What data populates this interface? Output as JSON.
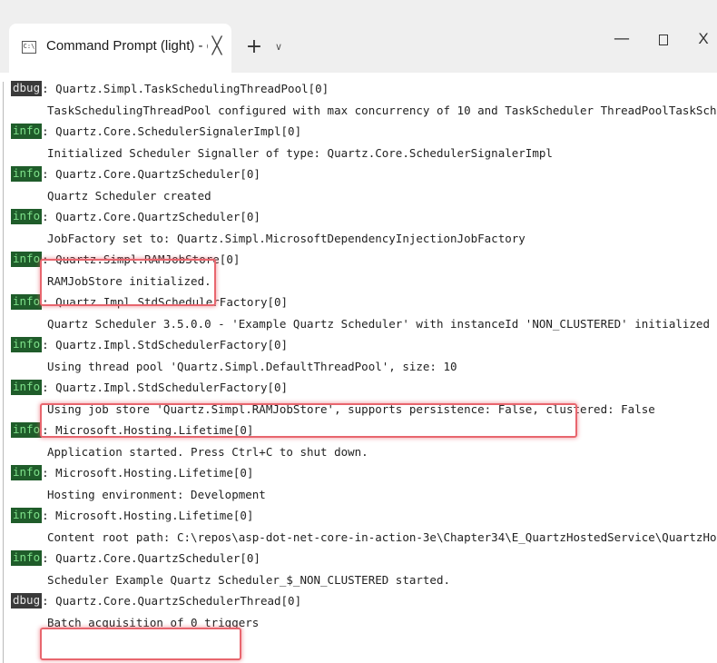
{
  "window": {
    "tab_title": "Command Prompt (light) - dot",
    "tab_icon_text": "C:\\",
    "tab_close_glyph": "╳",
    "new_tab_glyph": "+",
    "dropdown_glyph": "∨",
    "minimize_glyph": "—",
    "close_glyph": "X"
  },
  "console": {
    "lines": [
      {
        "level": "dbug",
        "category": "Quartz.Simpl.TaskSchedulingThreadPool[0]",
        "message": "TaskSchedulingThreadPool configured with max concurrency of 10 and TaskScheduler ThreadPoolTaskScheduler."
      },
      {
        "level": "info",
        "category": "Quartz.Core.SchedulerSignalerImpl[0]",
        "message": "Initialized Scheduler Signaller of type: Quartz.Core.SchedulerSignalerImpl"
      },
      {
        "level": "info",
        "category": "Quartz.Core.QuartzScheduler[0]",
        "message": "Quartz Scheduler created"
      },
      {
        "level": "info",
        "category": "Quartz.Core.QuartzScheduler[0]",
        "message": "JobFactory set to: Quartz.Simpl.MicrosoftDependencyInjectionJobFactory"
      },
      {
        "level": "info",
        "category": "Quartz.Simpl.RAMJobStore[0]",
        "message": "RAMJobStore initialized."
      },
      {
        "level": "info",
        "category": "Quartz.Impl.StdSchedulerFactory[0]",
        "message": "Quartz Scheduler 3.5.0.0 - 'Example Quartz Scheduler' with instanceId 'NON_CLUSTERED' initialized"
      },
      {
        "level": "info",
        "category": "Quartz.Impl.StdSchedulerFactory[0]",
        "message": "Using thread pool 'Quartz.Simpl.DefaultThreadPool', size: 10"
      },
      {
        "level": "info",
        "category": "Quartz.Impl.StdSchedulerFactory[0]",
        "message": "Using job store 'Quartz.Simpl.RAMJobStore', supports persistence: False, clustered: False"
      },
      {
        "level": "info",
        "category": "Microsoft.Hosting.Lifetime[0]",
        "message": "Application started. Press Ctrl+C to shut down."
      },
      {
        "level": "info",
        "category": "Microsoft.Hosting.Lifetime[0]",
        "message": "Hosting environment: Development"
      },
      {
        "level": "info",
        "category": "Microsoft.Hosting.Lifetime[0]",
        "message": "Content root path: C:\\repos\\asp-dot-net-core-in-action-3e\\Chapter34\\E_QuartzHostedService\\QuartzHostedService"
      },
      {
        "level": "info",
        "category": "Quartz.Core.QuartzScheduler[0]",
        "message": "Scheduler Example Quartz Scheduler_$_NON_CLUSTERED started."
      },
      {
        "level": "dbug",
        "category": "Quartz.Core.QuartzSchedulerThread[0]",
        "message": "Batch acquisition of 0 triggers"
      }
    ]
  },
  "highlight_color": "#e8666e",
  "badge_colors": {
    "info_bg": "#1f5c2a",
    "info_fg": "#7ee08a",
    "dbug_bg": "#3a3a3a",
    "dbug_fg": "#e6e6e6"
  }
}
